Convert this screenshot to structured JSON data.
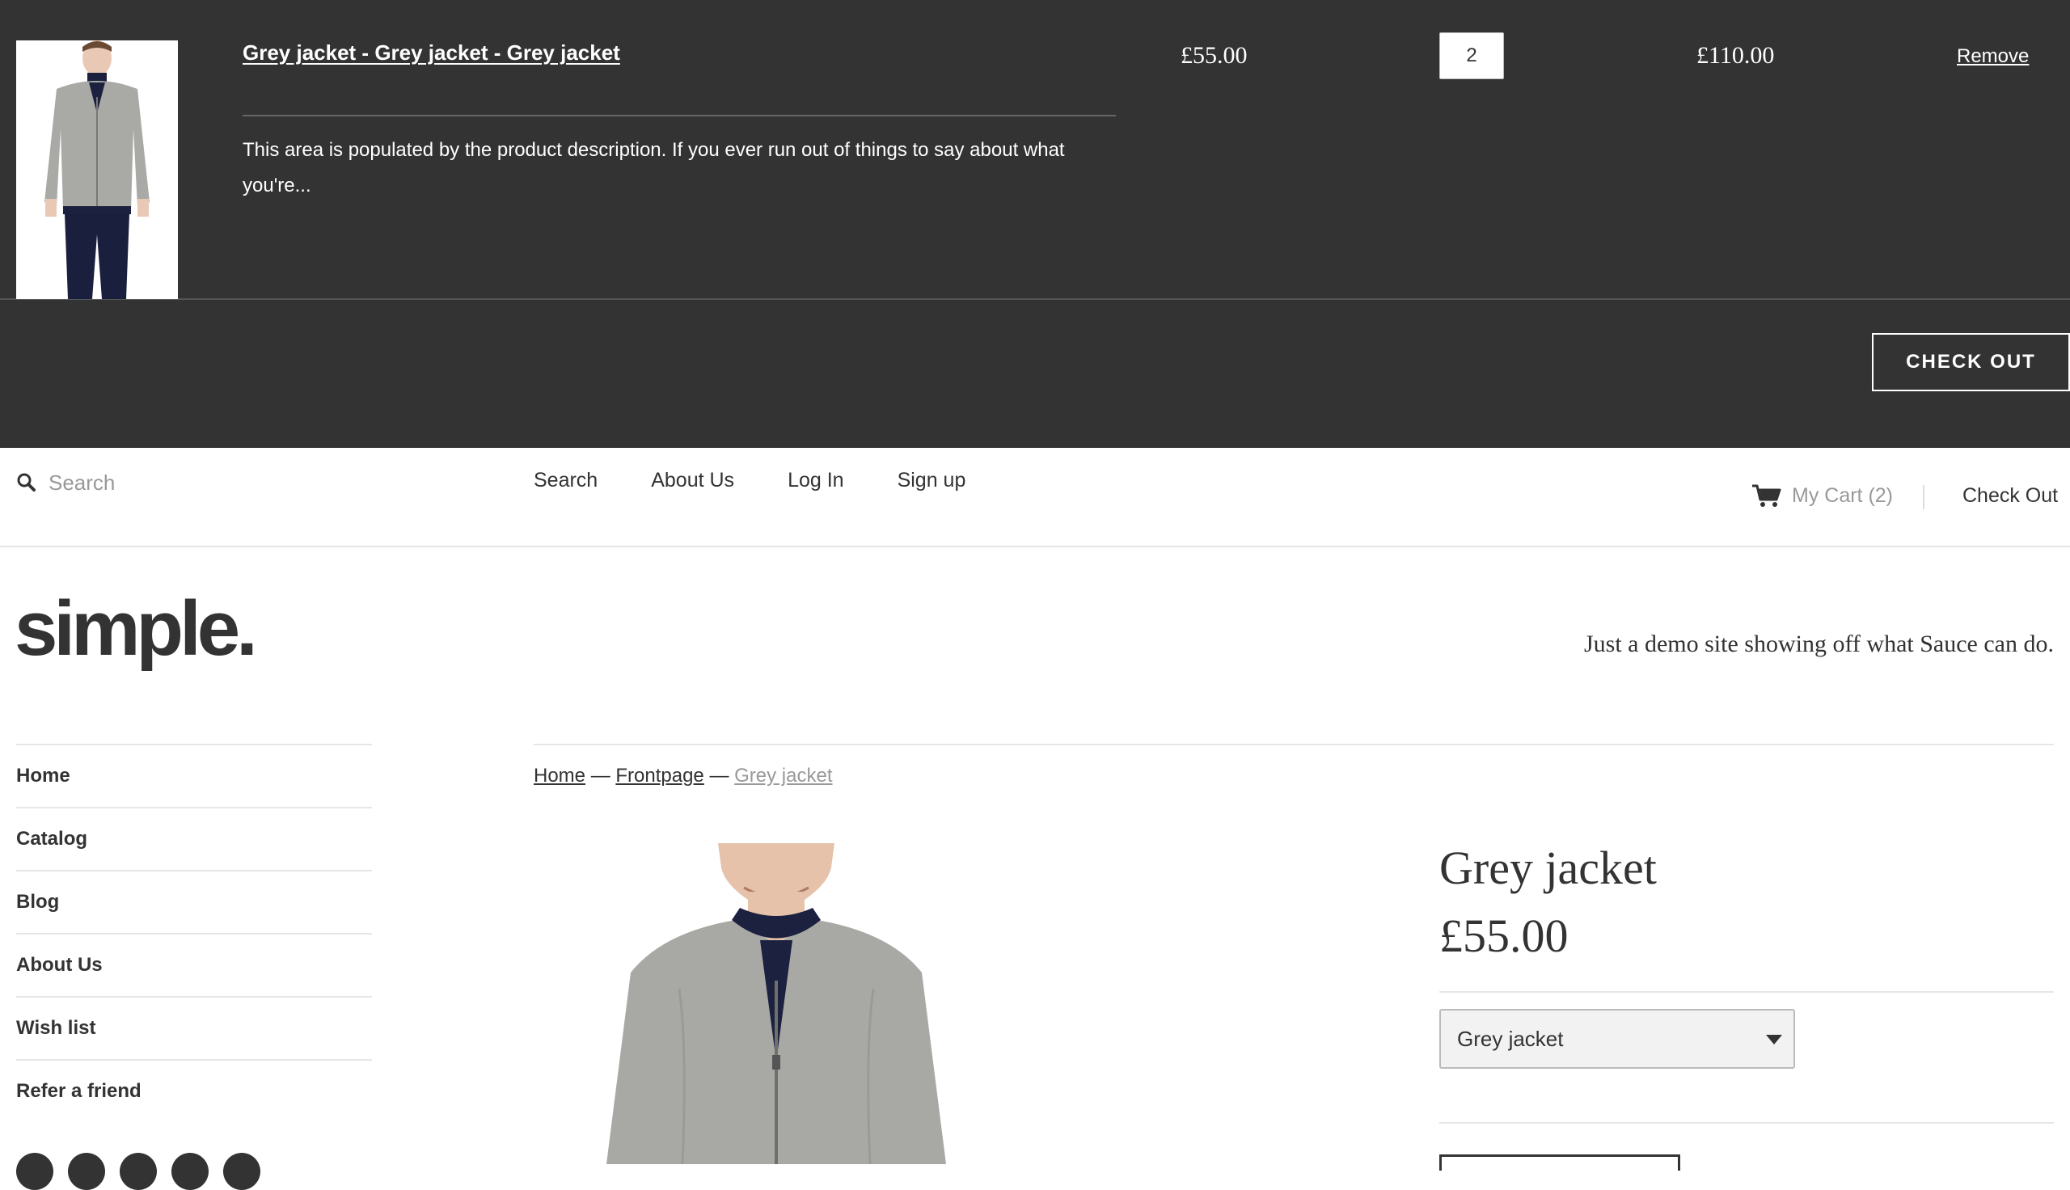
{
  "cart": {
    "item_title": "Grey jacket - Grey jacket - Grey jacket",
    "item_description": "This area is populated by the product description. If you ever run out of things to say about what you're...",
    "unit_price": "£55.00",
    "quantity": "2",
    "line_total": "£110.00",
    "remove_label": "Remove",
    "checkout_label": "CHECK OUT"
  },
  "topbar": {
    "search_placeholder": "Search",
    "nav": [
      "Search",
      "About Us",
      "Log In",
      "Sign up"
    ],
    "cart_label": "My Cart (2)",
    "checkout_label": "Check Out"
  },
  "header": {
    "logo": "simple.",
    "tagline": "Just a demo site showing off what Sauce can do."
  },
  "sidebar": {
    "items": [
      "Home",
      "Catalog",
      "Blog",
      "About Us",
      "Wish list",
      "Refer a friend"
    ]
  },
  "breadcrumb": {
    "home": "Home",
    "sep": "—",
    "collection": "Frontpage",
    "current": "Grey jacket"
  },
  "product": {
    "title": "Grey jacket",
    "price": "£55.00",
    "variant_selected": "Grey jacket"
  },
  "colors": {
    "drawer_bg": "#333333",
    "text_dark": "#333333",
    "muted": "#999999",
    "rule": "#e6e6e6"
  }
}
